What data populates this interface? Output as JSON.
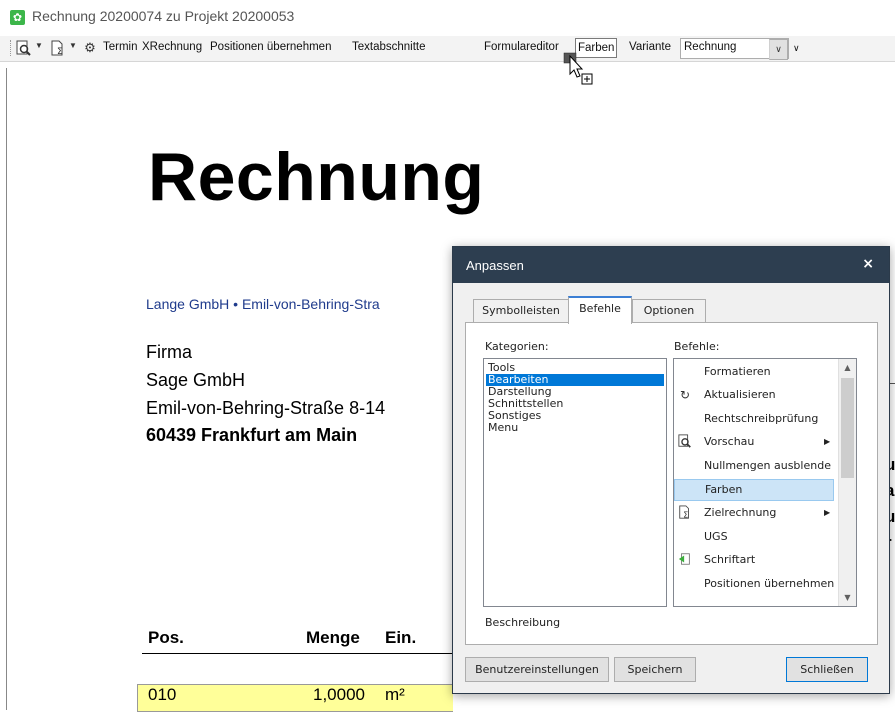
{
  "window": {
    "title": "Rechnung 20200074 zu Projekt 20200053",
    "icon": "app-gear-icon"
  },
  "toolbar": {
    "termin": "Termin",
    "xrechnung": "XRechnung",
    "positionen": "Positionen übernehmen",
    "textabschnitte": "Textabschnitte",
    "formulareditor": "Formulareditor",
    "farben": "Farben",
    "variante_label": "Variante",
    "variante_value": "Rechnung"
  },
  "document": {
    "title": "Rechnung",
    "sender_line": "Lange GmbH • Emil-von-Behring-Stra",
    "address": [
      "Firma",
      "Sage GmbH",
      "Emil-von-Behring-Straße 8-14",
      "60439 Frankfurt am Main"
    ],
    "table_headers": [
      "Pos.",
      "Menge",
      "Ein."
    ],
    "first_row": {
      "pos": "010",
      "menge": "1,0000",
      "einheit": "m²"
    },
    "right_edge_chars": [
      "u",
      "a",
      "u",
      "r"
    ]
  },
  "dialog": {
    "title": "Anpassen",
    "close": "×",
    "tabs": [
      "Symbolleisten",
      "Befehle",
      "Optionen"
    ],
    "active_tab": 1,
    "kategorien_label": "Kategorien:",
    "befehle_label": "Befehle:",
    "categories": [
      "Tools",
      "Bearbeiten",
      "Darstellung",
      "Schnittstellen",
      "Sonstiges",
      "Menu"
    ],
    "selected_category": 1,
    "commands": [
      {
        "label": "Formatieren",
        "icon": "",
        "submenu": false
      },
      {
        "label": "Aktualisieren",
        "icon": "refresh-icon",
        "submenu": false
      },
      {
        "label": "Rechtschreibprüfung",
        "icon": "",
        "submenu": false
      },
      {
        "label": "Vorschau",
        "icon": "preview-icon",
        "submenu": true
      },
      {
        "label": "Nullmengen ausblende",
        "icon": "",
        "submenu": false
      },
      {
        "label": "Farben",
        "icon": "",
        "submenu": false
      },
      {
        "label": "Zielrechnung",
        "icon": "sum-document-icon",
        "submenu": true
      },
      {
        "label": "UGS",
        "icon": "",
        "submenu": false
      },
      {
        "label": "Schriftart",
        "icon": "green-arrow-icon",
        "submenu": false
      },
      {
        "label": "Positionen übernehmen",
        "icon": "",
        "submenu": false
      }
    ],
    "selected_command": 5,
    "beschreibung_label": "Beschreibung",
    "buttons": {
      "benutzer": "Benutzereinstellungen",
      "speichern": "Speichern",
      "schliessen": "Schließen"
    }
  }
}
